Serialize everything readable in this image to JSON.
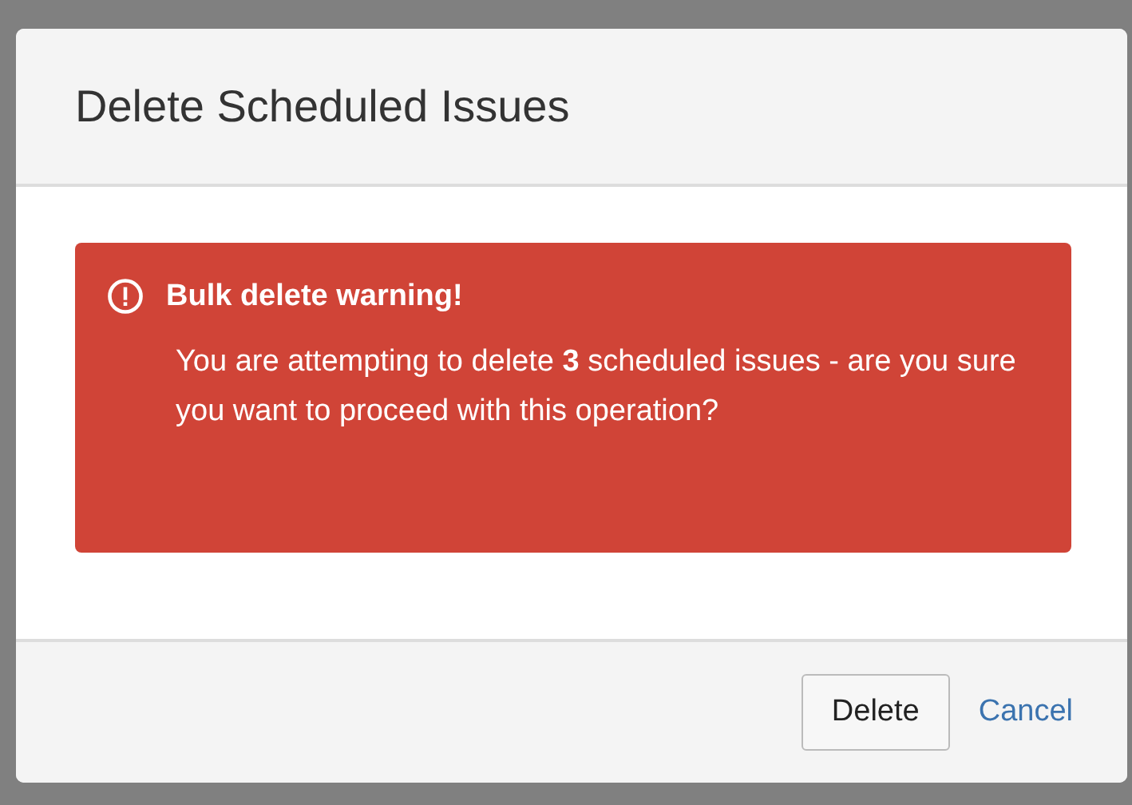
{
  "dialog": {
    "title": "Delete Scheduled Issues",
    "alert": {
      "kind": "error",
      "title": "Bulk delete warning!",
      "message": "You are attempting to delete **3** scheduled issues - are you sure you want to proceed with this operation?"
    },
    "buttons": [
      {
        "label": "Delete",
        "kind": "button"
      },
      {
        "label": "Cancel",
        "kind": "link"
      }
    ]
  }
}
